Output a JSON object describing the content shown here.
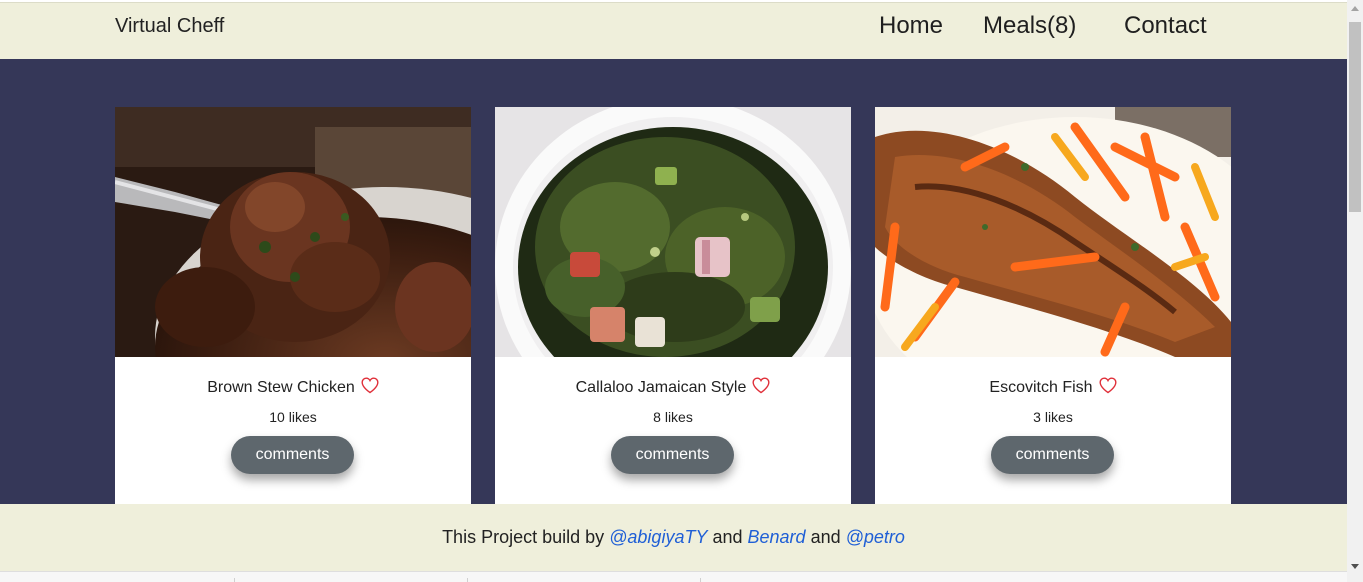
{
  "header": {
    "brand": "Virtual Cheff",
    "nav": {
      "home": "Home",
      "meals": "Meals(8)",
      "contact": "Contact"
    }
  },
  "meals": [
    {
      "name": "Brown Stew Chicken",
      "likes": "10 likes",
      "comments_label": "comments",
      "image": "brown-stew-chicken-photo"
    },
    {
      "name": "Callaloo Jamaican Style",
      "likes": "8 likes",
      "comments_label": "comments",
      "image": "callaloo-photo"
    },
    {
      "name": "Escovitch Fish",
      "likes": "3 likes",
      "comments_label": "comments",
      "image": "escovitch-fish-photo"
    }
  ],
  "footer": {
    "prefix": "This Project build by ",
    "author1": "@abigiyaTY",
    "and1": " and ",
    "author2": "Benard",
    "and2": " and ",
    "author3": "@petro"
  },
  "colors": {
    "header_bg": "#efefdb",
    "main_bg": "#353758",
    "button_bg": "#5e676d",
    "heart": "#e0303a",
    "link": "#1f5fd6"
  },
  "icons": {
    "like": "heart-outline-icon"
  }
}
